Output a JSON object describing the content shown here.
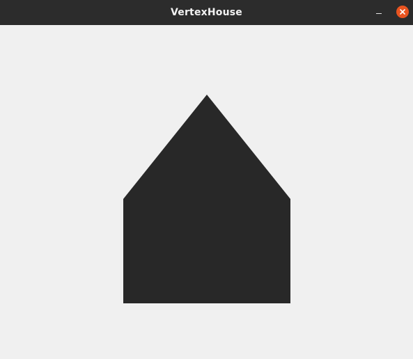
{
  "window": {
    "title": "VertexHouse",
    "controls": {
      "minimize_icon": "minimize-icon",
      "close_icon": "close-icon"
    }
  },
  "canvas": {
    "shape": "house",
    "fill_color": "#282828",
    "background_color": "#f0f0f0"
  },
  "colors": {
    "titlebar": "#2c2c2c",
    "title_text": "#f2f2f2",
    "close_button": "#e95420"
  }
}
